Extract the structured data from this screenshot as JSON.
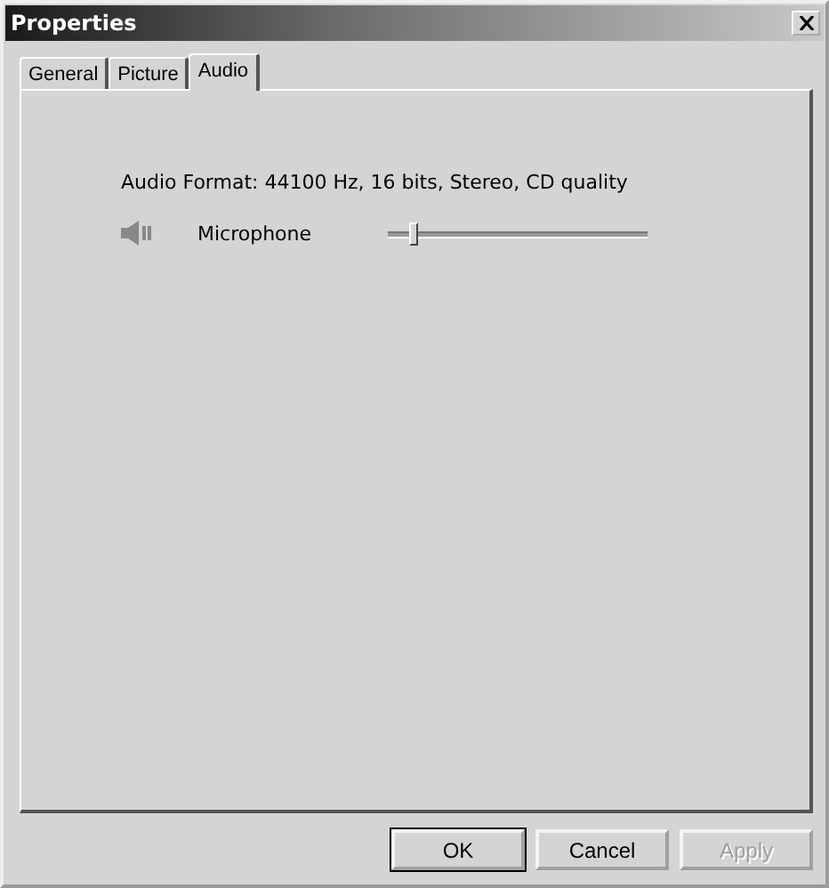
{
  "window": {
    "title": "Properties"
  },
  "tabs": [
    {
      "label": "General",
      "selected": false
    },
    {
      "label": "Picture",
      "selected": false
    },
    {
      "label": "Audio",
      "selected": true
    }
  ],
  "audio_format": "Audio Format: 44100 Hz, 16 bits, Stereo, CD quality",
  "channels": [
    {
      "name": "Microphone",
      "level": 0.09
    }
  ],
  "buttons": [
    {
      "label": "OK",
      "default": true,
      "disabled": false
    },
    {
      "label": "Cancel",
      "default": false,
      "disabled": false
    },
    {
      "label": "Apply",
      "default": false,
      "disabled": true
    }
  ]
}
